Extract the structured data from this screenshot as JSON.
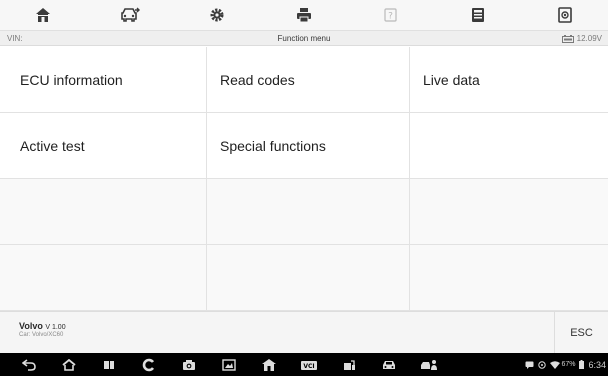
{
  "toolbar": {
    "icons": [
      "home-icon",
      "vehicle-icon",
      "settings-icon",
      "print-icon",
      "help-icon",
      "data-manager-icon",
      "screenshot-icon"
    ]
  },
  "infobar": {
    "vin_label": "VIN:",
    "title": "Function menu",
    "voltage": "12.09V"
  },
  "functions": [
    {
      "label": "ECU information"
    },
    {
      "label": "Read codes"
    },
    {
      "label": "Live data"
    },
    {
      "label": "Active test"
    },
    {
      "label": "Special functions"
    }
  ],
  "footer": {
    "make": "Volvo",
    "version": "V 1.00",
    "car": "Car: Volvo/XC60",
    "esc_label": "ESC"
  },
  "navbar": {
    "icons": [
      "back-icon",
      "home-nav-icon",
      "recent-apps-icon",
      "browser-icon",
      "camera-icon",
      "screen-capture-icon",
      "maxisys-home-icon",
      "vci-icon",
      "shop-icon",
      "vehicle-nav-icon",
      "remote-icon"
    ],
    "status": {
      "battery": "67%",
      "time": "6:34"
    }
  }
}
